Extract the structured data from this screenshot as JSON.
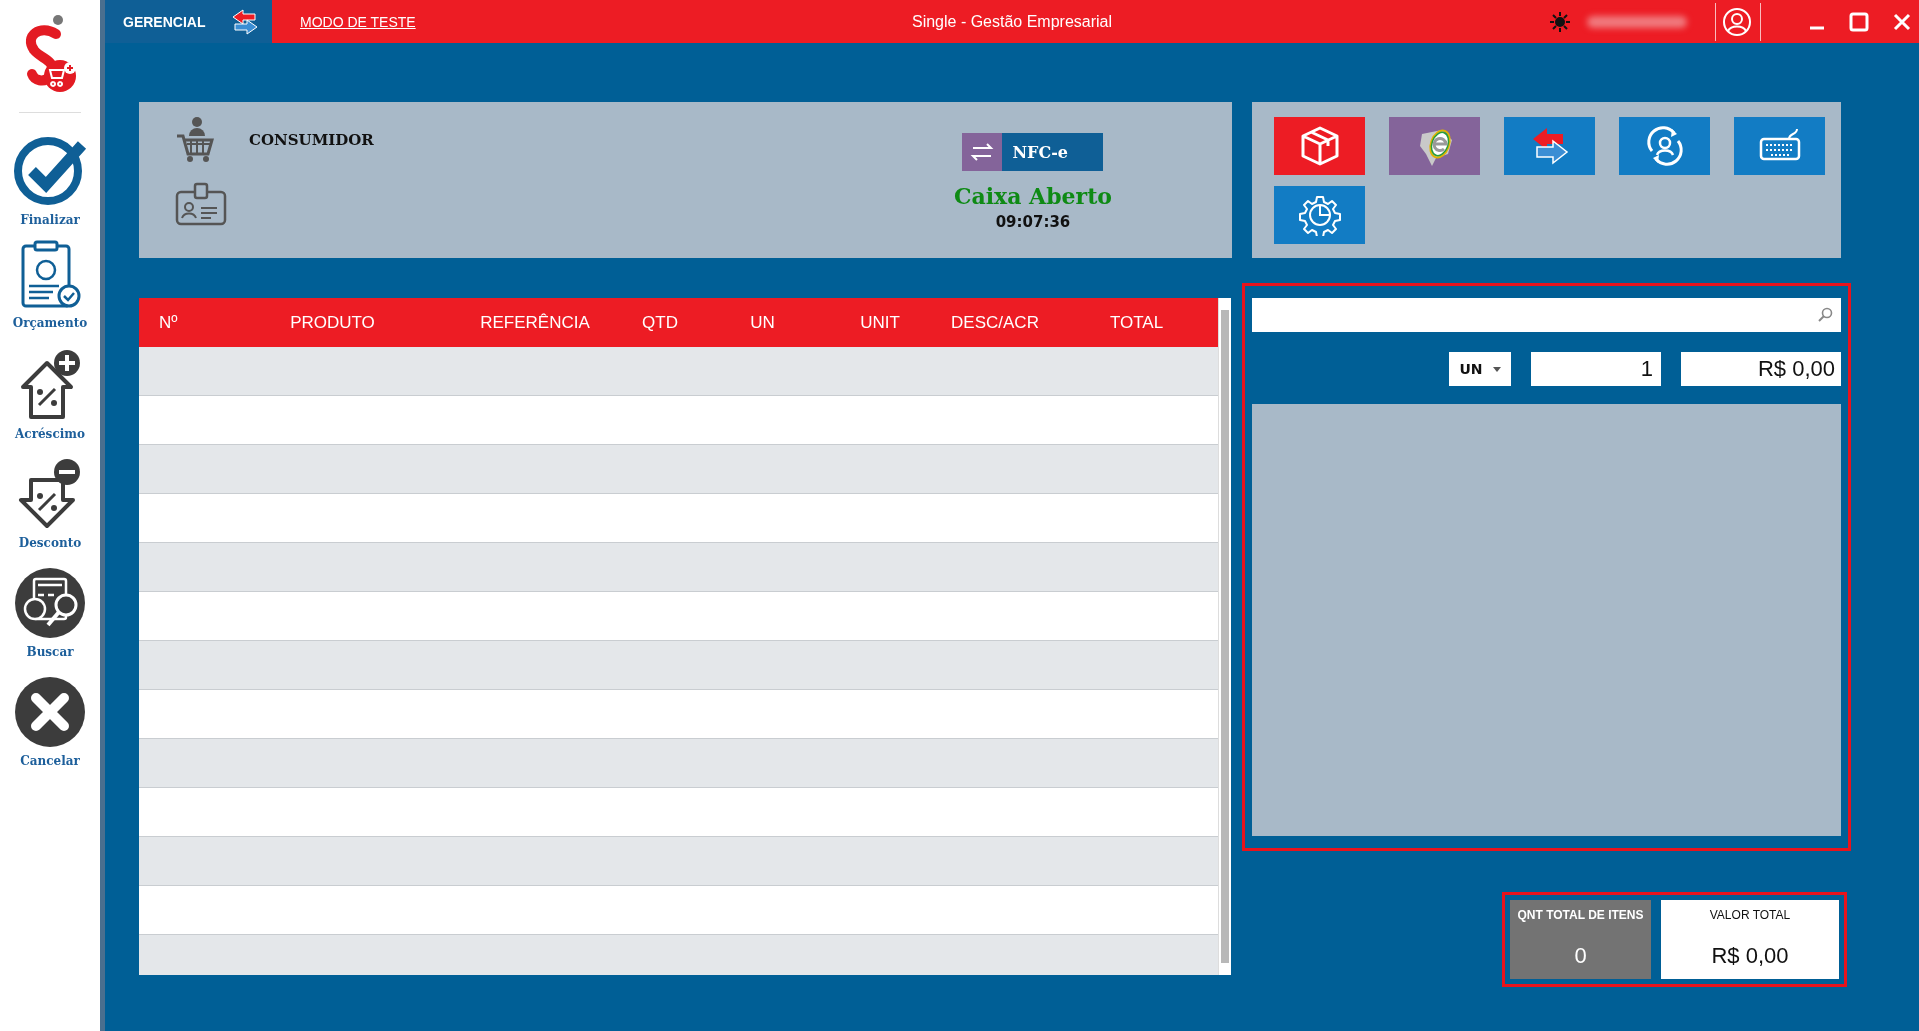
{
  "title_bar": {
    "mode": "GERENCIAL",
    "test_mode_link": "MODO DE TESTE",
    "title": "Single - Gestão Empresarial"
  },
  "sidebar": {
    "items": [
      {
        "kind": "finalize",
        "label": "Finalizar"
      },
      {
        "kind": "budget",
        "label": "Orçamento"
      },
      {
        "kind": "surcharge",
        "label": "Acréscimo"
      },
      {
        "kind": "discount",
        "label": "Desconto"
      },
      {
        "kind": "search",
        "label": "Buscar"
      },
      {
        "kind": "cancel",
        "label": "Cancelar"
      }
    ]
  },
  "customer": {
    "name": "CONSUMIDOR",
    "document_type": "NFC-e",
    "status": "Caixa Aberto",
    "time": "09:07:36"
  },
  "toolbar": {
    "buttons": [
      {
        "kind": "box",
        "color": "#ed1c24"
      },
      {
        "kind": "nfe",
        "color": "#84649a"
      },
      {
        "kind": "swap",
        "color": "#127cc4"
      },
      {
        "kind": "user-sync",
        "color": "#127cc4"
      },
      {
        "kind": "keyboard",
        "color": "#127cc4"
      },
      {
        "kind": "gear-chart",
        "color": "#127cc4"
      }
    ]
  },
  "table": {
    "columns": [
      "Nº",
      "PRODUTO",
      "REFERÊNCIA",
      "QTD",
      "UN",
      "UNIT",
      "DESC/ACR",
      "TOTAL"
    ]
  },
  "entry": {
    "unit": "UN",
    "quantity": "1",
    "price": "R$ 0,00"
  },
  "totals": {
    "items_label": "QNT TOTAL DE ITENS",
    "items_value": "0",
    "value_label": "VALOR TOTAL",
    "value": "R$ 0,00"
  }
}
